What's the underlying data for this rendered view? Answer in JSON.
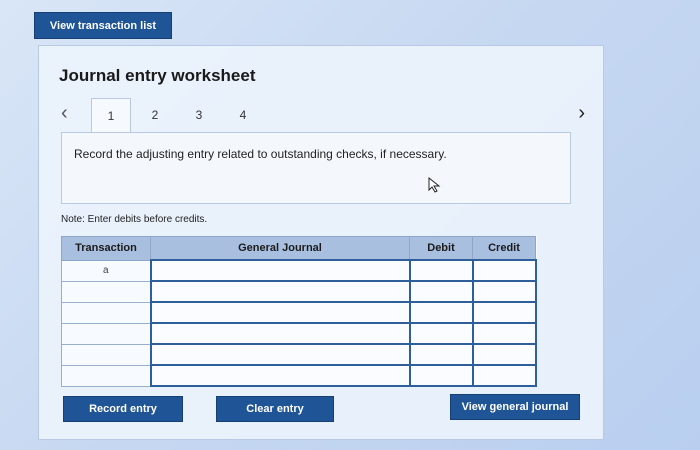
{
  "top_button": {
    "label": "View transaction list"
  },
  "worksheet": {
    "title": "Journal entry worksheet",
    "tabs": [
      {
        "label": "1",
        "active": true
      },
      {
        "label": "2",
        "active": false
      },
      {
        "label": "3",
        "active": false
      },
      {
        "label": "4",
        "active": false
      }
    ],
    "instruction": "Record the adjusting entry related to outstanding checks, if necessary.",
    "note": "Note: Enter debits before credits.",
    "table": {
      "headers": {
        "transaction": "Transaction",
        "general_journal": "General Journal",
        "debit": "Debit",
        "credit": "Credit"
      },
      "rows": [
        {
          "transaction": "a"
        },
        {
          "transaction": ""
        },
        {
          "transaction": ""
        },
        {
          "transaction": ""
        },
        {
          "transaction": ""
        },
        {
          "transaction": ""
        }
      ]
    },
    "buttons": {
      "record_entry": "Record entry",
      "clear_entry": "Clear entry",
      "view_general_journal": "View general journal"
    }
  },
  "icons": {
    "prev": "chevron-left-icon",
    "next": "chevron-right-icon",
    "cursor": "mouse-cursor-icon"
  }
}
